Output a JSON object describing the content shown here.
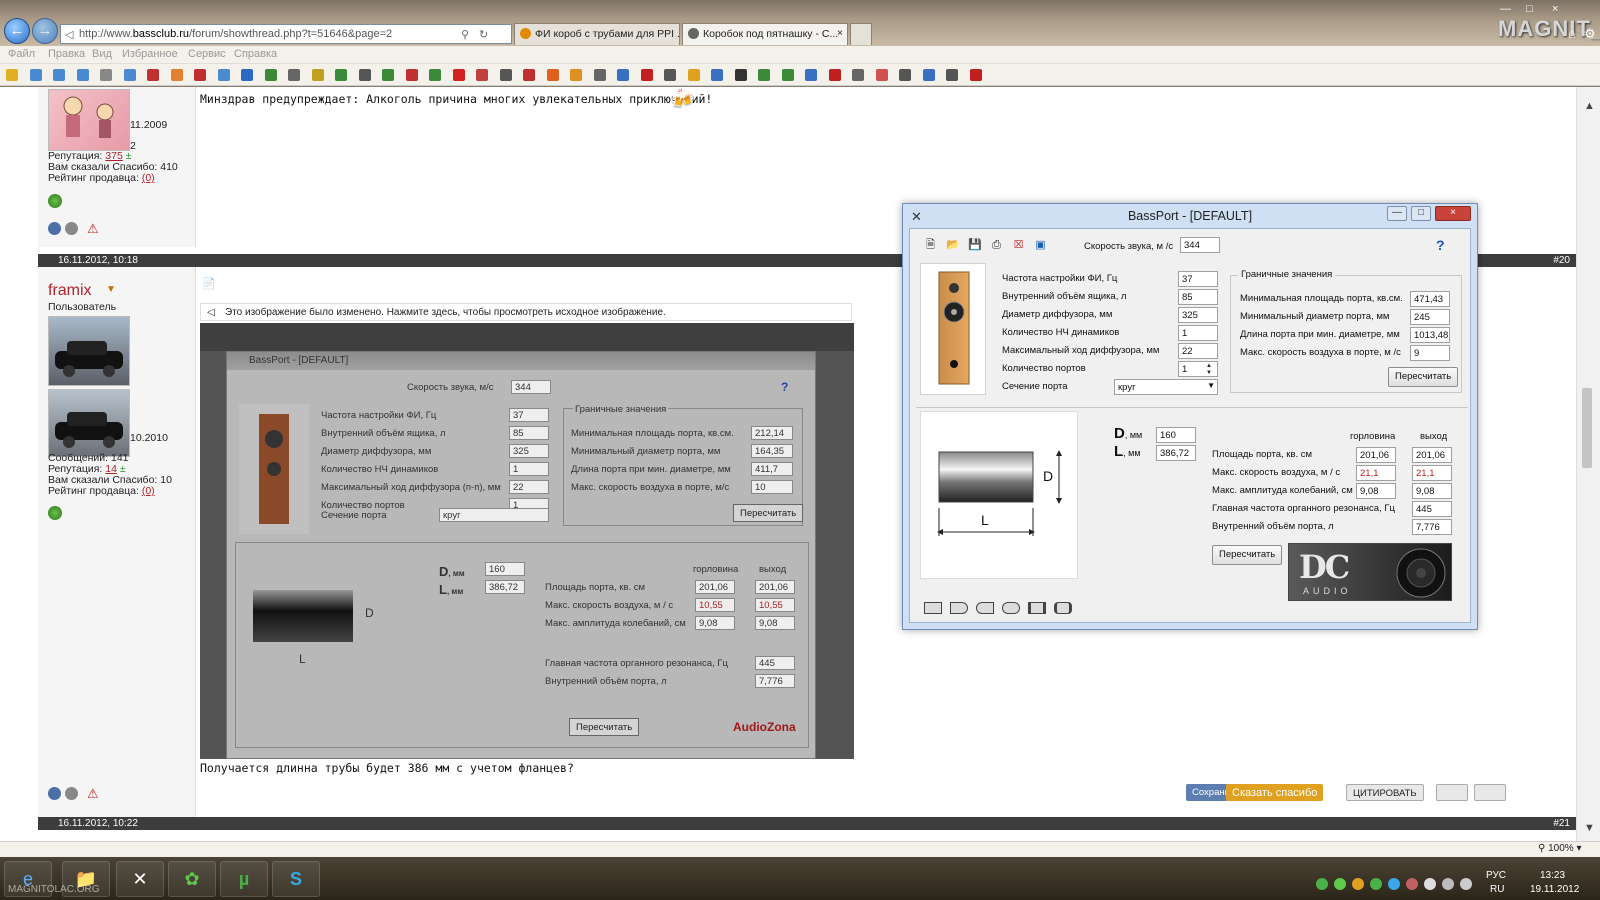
{
  "browser": {
    "address_host_prefix": "http://www.",
    "address_host": "bassclub.ru",
    "address_path": "/forum/showthread.php?t=51646&page=2",
    "tabs": [
      {
        "label": "ФИ короб с трубами для PPI ..."
      },
      {
        "label": "Коробок под пятнашку - С..."
      }
    ],
    "brand": "MAGNIT_LA",
    "menu": [
      "Файл",
      "Правка",
      "Вид",
      "Избранное",
      "Сервис",
      "Справка"
    ],
    "zoom": "100%"
  },
  "post_top": {
    "reg_date": "11.2009",
    "posts_fragment": "2",
    "reputation_label": "Репутация:",
    "reputation_value": "375",
    "thanks_label": "Вам сказали Спасибо: 410",
    "seller_label": "Рейтинг продавца:",
    "seller_value": "(0)",
    "signature": "Минздрав предупреждает: Алкоголь причина многих увлекательных приключений!"
  },
  "post_main": {
    "date": "16.11.2012, 10:18",
    "number": "#20",
    "username": "framix",
    "role": "Пользователь",
    "reg_date": "10.2010",
    "messages_label": "Сообщений: 141",
    "reputation_label": "Репутация:",
    "reputation_value": "14",
    "thanks_label": "Вам сказали Спасибо: 10",
    "seller_label": "Рейтинг продавца:",
    "seller_value": "(0)",
    "image_notice": "Это изображение было изменено. Нажмите здесь, чтобы просмотреть исходное изображение.",
    "text": "Получается длинна трубы будет 386 мм с учетом фланцев?",
    "btn_save": "Сохранить",
    "btn_save_badge": "B",
    "btn_thanks": "Сказать спасибо",
    "btn_quote": "ЦИТИРОВАТЬ"
  },
  "post_next": {
    "date": "16.11.2012, 10:22",
    "number": "#21"
  },
  "photo_app": {
    "title": "BassPort - [DEFAULT]",
    "sound_label": "Скорость звука, м/с",
    "sound_value": "344",
    "params": [
      {
        "label": "Частота настройки ФИ, Гц",
        "value": "37"
      },
      {
        "label": "Внутренний объём ящика, л",
        "value": "85"
      },
      {
        "label": "Диаметр диффузора, мм",
        "value": "325"
      },
      {
        "label": "Количество НЧ динамиков",
        "value": "1"
      },
      {
        "label": "Максимальный ход диффузора (п-п), мм",
        "value": "22"
      },
      {
        "label": "Количество портов",
        "value": "1"
      }
    ],
    "section_label": "Сечение порта",
    "section_value": "круг",
    "limits_title": "Граничные значения",
    "limits": [
      {
        "label": "Минимальная площадь порта, кв.см.",
        "value": "212,14"
      },
      {
        "label": "Минимальный диаметр порта, мм",
        "value": "164,35"
      },
      {
        "label": "Длина порта при мин. диаметре, мм",
        "value": "411,7"
      },
      {
        "label": "Макс. скорость воздуха в порте, м/с",
        "value": "10"
      }
    ],
    "recalc": "Пересчитать",
    "d_label": "D",
    "l_label": "L",
    "mm": ", мм",
    "d_value": "160",
    "l_value": "386,72",
    "col_throat": "горловина",
    "col_exit": "выход",
    "rows": [
      {
        "label": "Площадь порта, кв. см",
        "throat": "201,06",
        "exit": "201,06"
      },
      {
        "label": "Макс. скорость воздуха, м / с",
        "throat": "10,55",
        "exit": "10,55"
      },
      {
        "label": "Макс. амплитуда колебаний, см",
        "throat": "9,08",
        "exit": "9,08"
      }
    ],
    "resonance_label": "Главная частота органного резонанса, Гц",
    "resonance_value": "445",
    "volume_label": "Внутренний объём порта, л",
    "volume_value": "7,776",
    "logo": "AudioZona"
  },
  "bassport": {
    "title": "BassPort - [DEFAULT]",
    "sound_label": "Скорость звука, м /с",
    "sound_value": "344",
    "params": [
      {
        "label": "Частота настройки ФИ, Гц",
        "value": "37"
      },
      {
        "label": "Внутренний объём ящика, л",
        "value": "85"
      },
      {
        "label": "Диаметр диффузора, мм",
        "value": "325"
      },
      {
        "label": "Количество НЧ динамиков",
        "value": "1"
      },
      {
        "label": "Максимальный ход диффузора, мм",
        "value": "22"
      },
      {
        "label": "Количество портов",
        "value": "1"
      }
    ],
    "section_label": "Сечение порта",
    "section_value": "круг",
    "limits_title": "Граничные значения",
    "limits": [
      {
        "label": "Минимальная площадь порта, кв.см.",
        "value": "471,43"
      },
      {
        "label": "Минимальный диаметр порта, мм",
        "value": "245"
      },
      {
        "label": "Длина порта при мин. диаметре, мм",
        "value": "1013,48"
      },
      {
        "label": "Макс. скорость воздуха в порте, м /с",
        "value": "9"
      }
    ],
    "recalc": "Пересчитать",
    "d_label": "D",
    "l_label": "L",
    "mm": ", мм",
    "d_value": "160",
    "l_value": "386,72",
    "col_throat": "горловина",
    "col_exit": "выход",
    "rows": [
      {
        "label": "Площадь порта, кв. см",
        "throat": "201,06",
        "exit": "201,06"
      },
      {
        "label": "Макс. скорость воздуха, м / с",
        "throat": "21,1",
        "exit": "21,1"
      },
      {
        "label": "Макс. амплитуда колебаний, см",
        "throat": "9,08",
        "exit": "9,08"
      },
      {
        "label": "Главная частота органного резонанса, Гц",
        "throat": "",
        "exit": "445"
      },
      {
        "label": "Внутренний объём порта, л",
        "throat": "",
        "exit": "7,776"
      }
    ],
    "logo_main": "DC",
    "logo_sub": "AUDIO",
    "red_color": "#c02020"
  },
  "taskbar": {
    "lang": "РУС",
    "lang2": "RU",
    "time": "13:23",
    "date": "19.11.2012",
    "watermark": "MAGNITOLAC.ORG"
  }
}
